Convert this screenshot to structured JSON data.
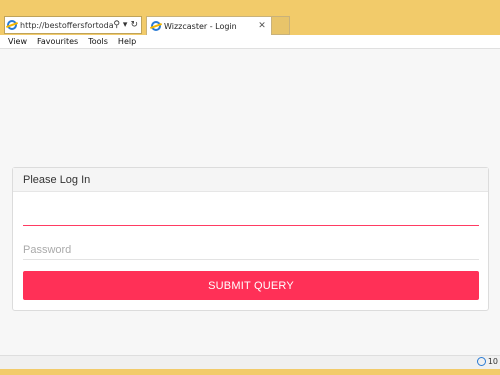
{
  "browser": {
    "address_url": "http://bestoffersfortoday...",
    "search_glyph": "⚲",
    "dropdown_glyph": "▾",
    "refresh_glyph": "↻",
    "tab_title": "Wizzcaster - Login",
    "tab_close_glyph": "✕",
    "zoom": "10"
  },
  "menu": {
    "items": [
      "View",
      "Favourites",
      "Tools",
      "Help"
    ]
  },
  "login": {
    "heading": "Please Log In",
    "username_value": "",
    "password_placeholder": "Password",
    "submit_label": "SUBMIT QUERY"
  },
  "colors": {
    "chrome": "#f2cb6a",
    "accent": "#ff3057"
  },
  "icons": {
    "browser": "ie-icon",
    "search": "search-icon",
    "refresh": "refresh-icon",
    "zoom": "globe-icon"
  }
}
